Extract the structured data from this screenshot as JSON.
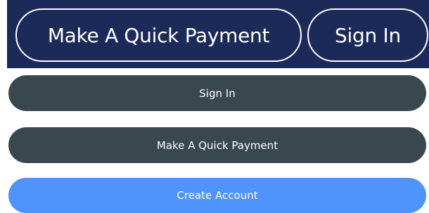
{
  "header": {
    "quick_payment_label": "Make A Quick Payment",
    "sign_in_label": "Sign In"
  },
  "actions": {
    "sign_in_label": "Sign In",
    "quick_payment_label": "Make A Quick Payment",
    "create_account_label": "Create Account"
  },
  "colors": {
    "header_bg": "#1b2a59",
    "dark_button": "#39474e",
    "primary_button": "#4f93fd",
    "button_text": "#ffffff"
  }
}
